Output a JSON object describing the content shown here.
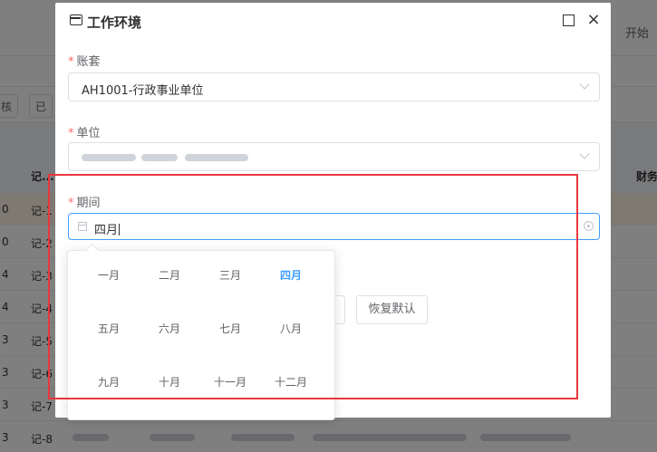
{
  "background": {
    "right_text": "开始",
    "tabs": [
      "核",
      "已"
    ],
    "table_header": {
      "col_no": "记...",
      "col_right": "财务"
    },
    "rows": [
      {
        "n": "0",
        "voucher": "记-1"
      },
      {
        "n": "0",
        "voucher": "记-2"
      },
      {
        "n": "4",
        "voucher": "记-3"
      },
      {
        "n": "4",
        "voucher": "记-4"
      },
      {
        "n": "3",
        "voucher": "记-5"
      },
      {
        "n": "3",
        "voucher": "记-6"
      },
      {
        "n": "3",
        "voucher": "记-7"
      },
      {
        "n": "3",
        "voucher": "记-8"
      }
    ]
  },
  "dialog": {
    "title": "工作环境",
    "account_set": {
      "label": "账套",
      "value": "AH1001-行政事业单位"
    },
    "unit": {
      "label": "单位"
    },
    "period": {
      "label": "期间",
      "value": "四月"
    },
    "restore_label": "恢复默认",
    "required_mark": "*"
  },
  "month_picker": {
    "months": [
      "一月",
      "二月",
      "三月",
      "四月",
      "五月",
      "六月",
      "七月",
      "八月",
      "九月",
      "十月",
      "十一月",
      "十二月"
    ],
    "current": "四月"
  },
  "colors": {
    "accent": "#409eff",
    "required": "#f56c6c",
    "highlight_box": "#e8383d",
    "row_highlight": "#fdf3e3"
  },
  "icons": [
    "window-icon",
    "maximize-icon",
    "close-icon",
    "chevron-down-icon",
    "calendar-icon",
    "clear-icon"
  ]
}
